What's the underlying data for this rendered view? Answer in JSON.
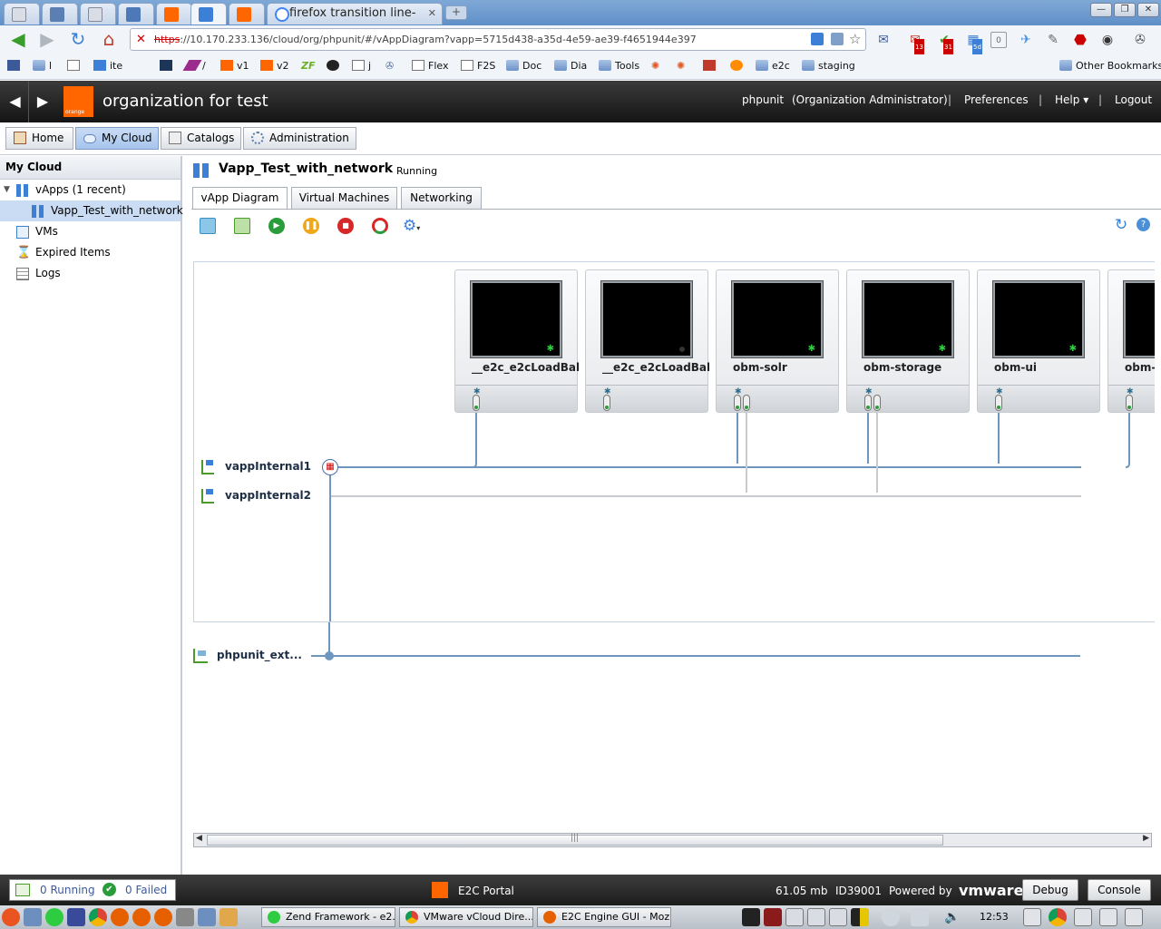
{
  "browser": {
    "tabs": [
      {
        "title": "",
        "color": "#d8dde6"
      },
      {
        "title": "",
        "color": "#5b7fb3"
      },
      {
        "title": "",
        "color": "#d8dde6"
      },
      {
        "title": "",
        "color": "#4d79b8"
      },
      {
        "title": "",
        "color": "#ff6600"
      },
      {
        "title": "",
        "color": "#3c7fd6"
      },
      {
        "title": "",
        "color": "#ff6600"
      },
      {
        "title": "firefox transition line-heig",
        "color": "#4285f4"
      }
    ],
    "url_scheme": "https",
    "url_rest": "://10.170.233.136/cloud/org/phpunit/#/vAppDiagram?vapp=5715d438-a35d-4e59-ae39-f4651944e397",
    "bookmarks": [
      "l",
      "ite",
      "/",
      "v1",
      "v2",
      "j",
      "Flex",
      "F2S",
      "Doc",
      "Dia",
      "Tools",
      "e2c",
      "staging",
      "Other Bookmarks"
    ],
    "ext_badges": [
      "13",
      "31",
      "5d",
      "0"
    ]
  },
  "app": {
    "org_name": "organization for test",
    "logo_text": "orange",
    "user": "phpunit",
    "role": "(Organization Administrator)",
    "preferences": "Preferences",
    "help": "Help",
    "logout": "Logout",
    "sep": "|"
  },
  "mainnav": {
    "home": "Home",
    "mycloud": "My Cloud",
    "catalogs": "Catalogs",
    "administration": "Administration"
  },
  "sidebar": {
    "title": "My Cloud",
    "vapps": "vApps (1 recent)",
    "vapp_item": "Vapp_Test_with_network",
    "vms": "VMs",
    "expired": "Expired Items",
    "logs": "Logs"
  },
  "vapp": {
    "title": "Vapp_Test_with_network",
    "status": "Running",
    "tabs": [
      "vApp Diagram",
      "Virtual Machines",
      "Networking"
    ],
    "vms": [
      {
        "name": "__e2c_e2cLoadBal",
        "state": "on"
      },
      {
        "name": "__e2c_e2cLoadBal",
        "state": "off"
      },
      {
        "name": "obm-solr",
        "state": "on"
      },
      {
        "name": "obm-storage",
        "state": "on"
      },
      {
        "name": "obm-ui",
        "state": "on"
      },
      {
        "name": "obm-",
        "state": "on"
      }
    ],
    "networks": [
      "vappInternal1",
      "vappInternal2"
    ],
    "external_network": "phpunit_ext..."
  },
  "statusbar": {
    "running": "0 Running",
    "failed": "0 Failed",
    "portal": "E2C Portal",
    "memory": "61.05 mb",
    "id": "ID39001",
    "powered": "Powered by",
    "vmware": "vmware",
    "debug": "Debug",
    "console": "Console"
  },
  "taskbar": {
    "tasks": [
      "Zend Framework - e2...",
      "VMware vCloud Dire...",
      "E2C Engine GUI - Moz..."
    ],
    "clock": "12:53"
  }
}
